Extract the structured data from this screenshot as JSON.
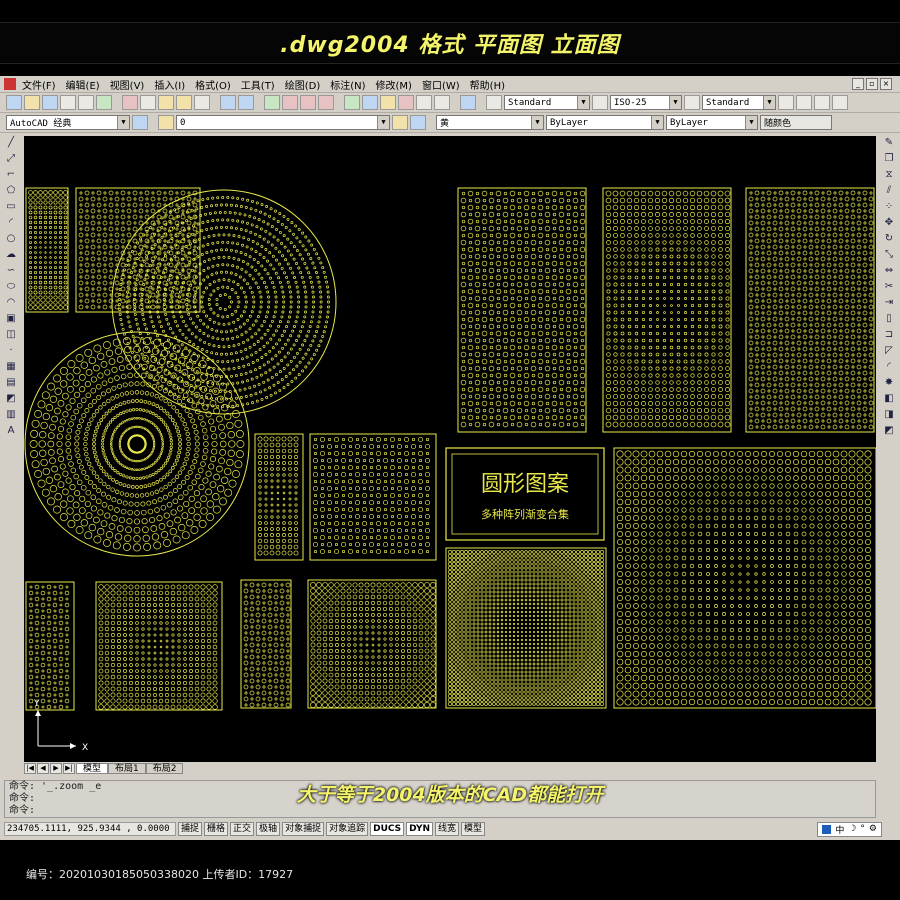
{
  "banner": {
    "title": ".dwg2004 格式  平面图 立面图"
  },
  "menu": {
    "items": [
      "文件(F)",
      "编辑(E)",
      "视图(V)",
      "插入(I)",
      "格式(O)",
      "工具(T)",
      "绘图(D)",
      "标注(N)",
      "修改(M)",
      "窗口(W)",
      "帮助(H)"
    ],
    "win_min": "_",
    "win_restore": "▫",
    "win_close": "×"
  },
  "toolbar1": {
    "text_style": "Standard",
    "dim_style": "ISO-25",
    "table_style": "Standard"
  },
  "toolbar2": {
    "workspace": "AutoCAD 经典",
    "layer": "0",
    "color": "黄",
    "linetype": "ByLayer",
    "lineweight": "ByLayer",
    "plotstyle": "随颜色"
  },
  "panel": {
    "title": "圆形图案",
    "subtitle": "多种阵列渐变合集"
  },
  "ucs": {
    "x": "X",
    "y": "Y"
  },
  "tabs": [
    "模型",
    "布局1",
    "布局2"
  ],
  "command": {
    "line1": "命令: '_.zoom _e",
    "line2": "命令:",
    "line3": "命令:",
    "overlay": "大于等于2004版本的CAD都能打开"
  },
  "status": {
    "coords": "234705.1111, 925.9344 , 0.0000",
    "buttons": [
      "捕捉",
      "栅格",
      "正交",
      "极轴",
      "对象捕捉",
      "对象追踪",
      "DUCS",
      "DYN",
      "线宽",
      "模型"
    ],
    "tray": [
      "中",
      "☽",
      "°",
      "⚙"
    ]
  },
  "footer": {
    "text": "编号：20201030185050338020 上传者ID：17927"
  },
  "colors": {
    "cad_yellow": "#e8e84a",
    "banner_text": "#f4f46a",
    "ui_gray": "#d4d0c8"
  }
}
